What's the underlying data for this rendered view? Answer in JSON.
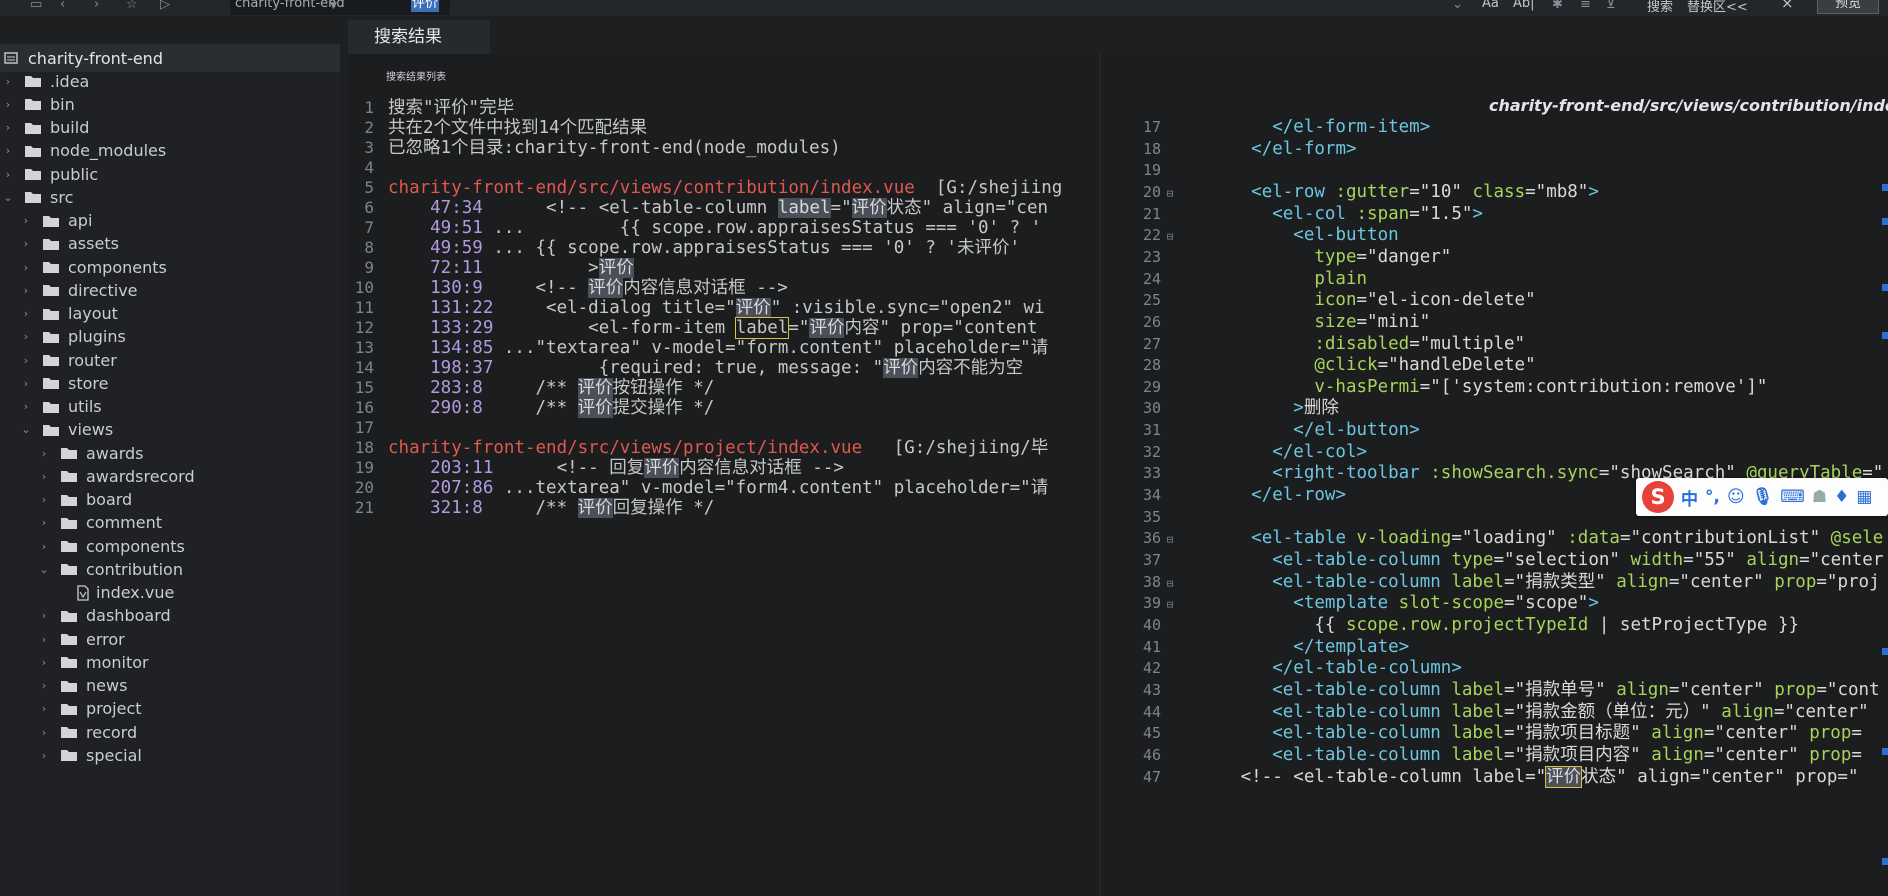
{
  "toolbar": {
    "scope_label": "charity-front-end",
    "search_query": "评价",
    "aa_label": "Aa",
    "ab_label": "Ab|",
    "search_label": "搜索",
    "replace_label": "替换区<<",
    "close_symbol": "×",
    "preview_label": "预览"
  },
  "sidebar": {
    "root": "charity-front-end",
    "items": [
      {
        "label": ".idea",
        "depth": 0,
        "open": false
      },
      {
        "label": "bin",
        "depth": 0,
        "open": false
      },
      {
        "label": "build",
        "depth": 0,
        "open": false
      },
      {
        "label": "node_modules",
        "depth": 0,
        "open": false
      },
      {
        "label": "public",
        "depth": 0,
        "open": false
      },
      {
        "label": "src",
        "depth": 0,
        "open": true
      },
      {
        "label": "api",
        "depth": 1,
        "open": false
      },
      {
        "label": "assets",
        "depth": 1,
        "open": false
      },
      {
        "label": "components",
        "depth": 1,
        "open": false
      },
      {
        "label": "directive",
        "depth": 1,
        "open": false
      },
      {
        "label": "layout",
        "depth": 1,
        "open": false
      },
      {
        "label": "plugins",
        "depth": 1,
        "open": false
      },
      {
        "label": "router",
        "depth": 1,
        "open": false
      },
      {
        "label": "store",
        "depth": 1,
        "open": false
      },
      {
        "label": "utils",
        "depth": 1,
        "open": false
      },
      {
        "label": "views",
        "depth": 1,
        "open": true
      },
      {
        "label": "awards",
        "depth": 2,
        "open": false
      },
      {
        "label": "awardsrecord",
        "depth": 2,
        "open": false
      },
      {
        "label": "board",
        "depth": 2,
        "open": false
      },
      {
        "label": "comment",
        "depth": 2,
        "open": false
      },
      {
        "label": "components",
        "depth": 2,
        "open": false
      },
      {
        "label": "contribution",
        "depth": 2,
        "open": true
      },
      {
        "label": "index.vue",
        "depth": 3,
        "file": true
      },
      {
        "label": "dashboard",
        "depth": 2,
        "open": false
      },
      {
        "label": "error",
        "depth": 2,
        "open": false
      },
      {
        "label": "monitor",
        "depth": 2,
        "open": false
      },
      {
        "label": "news",
        "depth": 2,
        "open": false
      },
      {
        "label": "project",
        "depth": 2,
        "open": false
      },
      {
        "label": "record",
        "depth": 2,
        "open": false
      },
      {
        "label": "special",
        "depth": 2,
        "open": false
      }
    ]
  },
  "main": {
    "tab_label": "搜索结果",
    "search_list_header": "搜索结果列表",
    "file_path": "charity-front-end/src/views/contribution/index.vue"
  },
  "search_lines": [
    {
      "n": "1",
      "parts": [
        [
          "t",
          "搜索\"评价\"完毕"
        ]
      ]
    },
    {
      "n": "2",
      "parts": [
        [
          "t",
          "共在2个文件中找到14个匹配结果"
        ]
      ]
    },
    {
      "n": "3",
      "parts": [
        [
          "t",
          "已忽略1个目录:charity-front-end(node_modules)"
        ]
      ]
    },
    {
      "n": "4",
      "parts": []
    },
    {
      "n": "5",
      "parts": [
        [
          "p",
          "charity-front-end/src/views/contribution/index.vue"
        ],
        [
          "t",
          "  [G:/shejiing"
        ]
      ]
    },
    {
      "n": "6",
      "parts": [
        [
          "l",
          "    47:34"
        ],
        [
          "t",
          "      <!-- <el-table-column "
        ],
        [
          "h",
          "label"
        ],
        [
          "t",
          "=\""
        ],
        [
          "h",
          "评价"
        ],
        [
          "t",
          "状态\" align=\"cen"
        ]
      ]
    },
    {
      "n": "7",
      "parts": [
        [
          "l",
          "    49:51"
        ],
        [
          "t",
          " ...         {{ scope.row.appraisesStatus === '0' ? '"
        ]
      ]
    },
    {
      "n": "8",
      "parts": [
        [
          "l",
          "    49:59"
        ],
        [
          "t",
          " ... {{ scope.row.appraisesStatus === '0' ? '未评价'"
        ]
      ]
    },
    {
      "n": "9",
      "parts": [
        [
          "l",
          "    72:11"
        ],
        [
          "t",
          "          >"
        ],
        [
          "h",
          "评价"
        ]
      ]
    },
    {
      "n": "10",
      "parts": [
        [
          "l",
          "    130:9"
        ],
        [
          "t",
          "     <!-- "
        ],
        [
          "h",
          "评价"
        ],
        [
          "t",
          "内容信息对话框 -->"
        ]
      ]
    },
    {
      "n": "11",
      "parts": [
        [
          "l",
          "    131:22"
        ],
        [
          "t",
          "     <el-dialog title=\""
        ],
        [
          "h",
          "评价"
        ],
        [
          "t",
          "\" :visible.sync=\"open2\" wi"
        ]
      ]
    },
    {
      "n": "12",
      "parts": [
        [
          "l",
          "    133:29"
        ],
        [
          "t",
          "         <el-form-item "
        ],
        [
          "b",
          "label"
        ],
        [
          "t",
          "=\""
        ],
        [
          "h",
          "评价"
        ],
        [
          "t",
          "内容\" prop=\"content"
        ]
      ]
    },
    {
      "n": "13",
      "parts": [
        [
          "l",
          "    134:85"
        ],
        [
          "t",
          " ...\"textarea\" v-model=\"form.content\" placeholder=\"请"
        ]
      ]
    },
    {
      "n": "14",
      "parts": [
        [
          "l",
          "    198:37"
        ],
        [
          "t",
          "          {required: true, message: \""
        ],
        [
          "h",
          "评价"
        ],
        [
          "t",
          "内容不能为空"
        ]
      ]
    },
    {
      "n": "15",
      "parts": [
        [
          "l",
          "    283:8"
        ],
        [
          "t",
          "     /** "
        ],
        [
          "h",
          "评价"
        ],
        [
          "t",
          "按钮操作 */"
        ]
      ]
    },
    {
      "n": "16",
      "parts": [
        [
          "l",
          "    290:8"
        ],
        [
          "t",
          "     /** "
        ],
        [
          "h",
          "评价"
        ],
        [
          "t",
          "提交操作 */"
        ]
      ]
    },
    {
      "n": "17",
      "parts": []
    },
    {
      "n": "18",
      "parts": [
        [
          "p",
          "charity-front-end/src/views/project/index.vue"
        ],
        [
          "t",
          "   [G:/shejiing/毕"
        ]
      ]
    },
    {
      "n": "19",
      "parts": [
        [
          "l",
          "    203:11"
        ],
        [
          "t",
          "      <!-- 回复"
        ],
        [
          "h",
          "评价"
        ],
        [
          "t",
          "内容信息对话框 -->"
        ]
      ]
    },
    {
      "n": "20",
      "parts": [
        [
          "l",
          "    207:86"
        ],
        [
          "t",
          " ...textarea\" v-model=\"form4.content\" placeholder=\"请"
        ]
      ]
    },
    {
      "n": "21",
      "parts": [
        [
          "l",
          "    321:8"
        ],
        [
          "t",
          "     /** "
        ],
        [
          "h",
          "评价"
        ],
        [
          "t",
          "回复操作 */"
        ]
      ]
    }
  ],
  "file_lines": [
    {
      "n": "17",
      "f": "",
      "parts": [
        [
          "s",
          "      "
        ],
        [
          "g",
          "</el-form-item>"
        ]
      ]
    },
    {
      "n": "18",
      "f": "",
      "parts": [
        [
          "s",
          "    "
        ],
        [
          "g",
          "</el-form>"
        ]
      ]
    },
    {
      "n": "19",
      "f": "",
      "parts": []
    },
    {
      "n": "20",
      "f": "⊟",
      "parts": [
        [
          "s",
          "    "
        ],
        [
          "g",
          "<el-row "
        ],
        [
          "a",
          ":gutter"
        ],
        [
          "x",
          "=\"10\" "
        ],
        [
          "a",
          "class"
        ],
        [
          "x",
          "=\"mb8\""
        ],
        [
          "g",
          ">"
        ]
      ]
    },
    {
      "n": "21",
      "f": "",
      "parts": [
        [
          "s",
          "      "
        ],
        [
          "g",
          "<el-col "
        ],
        [
          "a",
          ":span"
        ],
        [
          "x",
          "=\"1.5\""
        ],
        [
          "g",
          ">"
        ]
      ]
    },
    {
      "n": "22",
      "f": "⊟",
      "parts": [
        [
          "s",
          "        "
        ],
        [
          "g",
          "<el-button"
        ]
      ]
    },
    {
      "n": "23",
      "f": "",
      "parts": [
        [
          "s",
          "          "
        ],
        [
          "a",
          "type"
        ],
        [
          "x",
          "=\"danger\""
        ]
      ]
    },
    {
      "n": "24",
      "f": "",
      "parts": [
        [
          "s",
          "          "
        ],
        [
          "a",
          "plain"
        ]
      ]
    },
    {
      "n": "25",
      "f": "",
      "parts": [
        [
          "s",
          "          "
        ],
        [
          "a",
          "icon"
        ],
        [
          "x",
          "=\"el-icon-delete\""
        ]
      ]
    },
    {
      "n": "26",
      "f": "",
      "parts": [
        [
          "s",
          "          "
        ],
        [
          "a",
          "size"
        ],
        [
          "x",
          "=\"mini\""
        ]
      ]
    },
    {
      "n": "27",
      "f": "",
      "parts": [
        [
          "s",
          "          "
        ],
        [
          "a",
          ":disabled"
        ],
        [
          "x",
          "=\"multiple\""
        ]
      ]
    },
    {
      "n": "28",
      "f": "",
      "parts": [
        [
          "s",
          "          "
        ],
        [
          "a",
          "@click"
        ],
        [
          "x",
          "=\"handleDelete\""
        ]
      ]
    },
    {
      "n": "29",
      "f": "",
      "parts": [
        [
          "s",
          "          "
        ],
        [
          "a",
          "v-hasPermi"
        ],
        [
          "x",
          "=\"['system:contribution:remove']\""
        ]
      ]
    },
    {
      "n": "30",
      "f": "",
      "parts": [
        [
          "s",
          "        "
        ],
        [
          "g",
          ">"
        ],
        [
          "x",
          "删除"
        ]
      ]
    },
    {
      "n": "31",
      "f": "",
      "parts": [
        [
          "s",
          "        "
        ],
        [
          "g",
          "</el-button>"
        ]
      ]
    },
    {
      "n": "32",
      "f": "",
      "parts": [
        [
          "s",
          "      "
        ],
        [
          "g",
          "</el-col>"
        ]
      ]
    },
    {
      "n": "33",
      "f": "",
      "parts": [
        [
          "s",
          "      "
        ],
        [
          "g",
          "<right-toolbar "
        ],
        [
          "a",
          ":showSearch.sync"
        ],
        [
          "x",
          "=\"showSearch\" "
        ],
        [
          "a",
          "@queryTable"
        ],
        [
          "x",
          "=\""
        ]
      ]
    },
    {
      "n": "34",
      "f": "",
      "parts": [
        [
          "s",
          "    "
        ],
        [
          "g",
          "</el-row>"
        ]
      ]
    },
    {
      "n": "35",
      "f": "",
      "parts": []
    },
    {
      "n": "36",
      "f": "⊟",
      "parts": [
        [
          "s",
          "    "
        ],
        [
          "g",
          "<el-table "
        ],
        [
          "a",
          "v-loading"
        ],
        [
          "x",
          "=\"loading\" "
        ],
        [
          "a",
          ":data"
        ],
        [
          "x",
          "=\"contributionList\" "
        ],
        [
          "a",
          "@sele"
        ]
      ]
    },
    {
      "n": "37",
      "f": "",
      "parts": [
        [
          "s",
          "      "
        ],
        [
          "g",
          "<el-table-column "
        ],
        [
          "a",
          "type"
        ],
        [
          "x",
          "=\"selection\" "
        ],
        [
          "a",
          "width"
        ],
        [
          "x",
          "=\"55\" "
        ],
        [
          "a",
          "align"
        ],
        [
          "x",
          "=\"center"
        ]
      ]
    },
    {
      "n": "38",
      "f": "⊟",
      "parts": [
        [
          "s",
          "      "
        ],
        [
          "g",
          "<el-table-column "
        ],
        [
          "a",
          "label"
        ],
        [
          "x",
          "=\"捐款类型\" "
        ],
        [
          "a",
          "align"
        ],
        [
          "x",
          "=\"center\" "
        ],
        [
          "a",
          "prop"
        ],
        [
          "x",
          "=\"proj"
        ]
      ]
    },
    {
      "n": "39",
      "f": "⊟",
      "parts": [
        [
          "s",
          "        "
        ],
        [
          "g",
          "<template "
        ],
        [
          "a",
          "slot-scope"
        ],
        [
          "x",
          "=\"scope\""
        ],
        [
          "g",
          ">"
        ]
      ]
    },
    {
      "n": "40",
      "f": "",
      "parts": [
        [
          "s",
          "          "
        ],
        [
          "x",
          "{{ "
        ],
        [
          "a",
          "scope.row.projectTypeId"
        ],
        [
          "x",
          " | setProjectType }}"
        ]
      ]
    },
    {
      "n": "41",
      "f": "",
      "parts": [
        [
          "s",
          "        "
        ],
        [
          "g",
          "</template>"
        ]
      ]
    },
    {
      "n": "42",
      "f": "",
      "parts": [
        [
          "s",
          "      "
        ],
        [
          "g",
          "</el-table-column>"
        ]
      ]
    },
    {
      "n": "43",
      "f": "",
      "parts": [
        [
          "s",
          "      "
        ],
        [
          "g",
          "<el-table-column "
        ],
        [
          "a",
          "label"
        ],
        [
          "x",
          "=\"捐款单号\" "
        ],
        [
          "a",
          "align"
        ],
        [
          "x",
          "=\"center\" "
        ],
        [
          "a",
          "prop"
        ],
        [
          "x",
          "=\"cont"
        ]
      ]
    },
    {
      "n": "44",
      "f": "",
      "parts": [
        [
          "s",
          "      "
        ],
        [
          "g",
          "<el-table-column "
        ],
        [
          "a",
          "label"
        ],
        [
          "x",
          "=\"捐款金额（单位：元）\" "
        ],
        [
          "a",
          "align"
        ],
        [
          "x",
          "=\"center\""
        ]
      ]
    },
    {
      "n": "45",
      "f": "",
      "parts": [
        [
          "s",
          "      "
        ],
        [
          "g",
          "<el-table-column "
        ],
        [
          "a",
          "label"
        ],
        [
          "x",
          "=\"捐款项目标题\" "
        ],
        [
          "a",
          "align"
        ],
        [
          "x",
          "=\"center\" "
        ],
        [
          "a",
          "prop"
        ],
        [
          "x",
          "="
        ]
      ]
    },
    {
      "n": "46",
      "f": "",
      "parts": [
        [
          "s",
          "      "
        ],
        [
          "g",
          "<el-table-column "
        ],
        [
          "a",
          "label"
        ],
        [
          "x",
          "=\"捐款项目内容\" "
        ],
        [
          "a",
          "align"
        ],
        [
          "x",
          "=\"center\" "
        ],
        [
          "a",
          "prop"
        ],
        [
          "x",
          "="
        ]
      ]
    },
    {
      "n": "47",
      "f": "",
      "parts": [
        [
          "s",
          "   "
        ],
        [
          "x",
          "<!-- <el-table-column label=\""
        ],
        [
          "h",
          "评价"
        ],
        [
          "x",
          "状态\" align=\"center\" prop=\""
        ]
      ]
    }
  ],
  "ime": {
    "logo": "S",
    "mode": "中",
    "punct": "°,",
    "icons": [
      "emoji-icon",
      "microphone-icon",
      "keyboard-icon",
      "user-icon",
      "shirt-icon",
      "grid-icon"
    ]
  }
}
